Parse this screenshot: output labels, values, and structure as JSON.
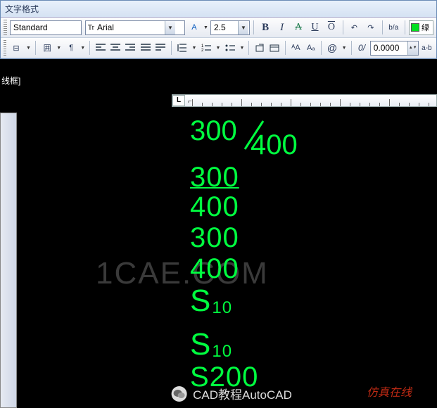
{
  "panel": {
    "title": "文字格式"
  },
  "row1": {
    "style": "Standard",
    "font_prefix": "Tr",
    "font": "Arial",
    "layer_btn": "A",
    "size": "2.5",
    "bold": "B",
    "italic": "I",
    "strike": "A",
    "under": "U",
    "over": "O",
    "undo": "↶",
    "redo": "↷",
    "fraction_btn": "b/a",
    "color_label": "绿"
  },
  "row2": {
    "ruler": "⊟",
    "columns": "囲",
    "para": "¶",
    "align_l": "≡",
    "align_c": "≡",
    "align_r": "≡",
    "align_j": "≡",
    "align_d": "≡",
    "numlist": "≡",
    "bullist": "≡",
    "uclc": "≡",
    "insert": "⎘",
    "fieldA": "ᴬA",
    "fieldAa": "Aₐ",
    "at": "@",
    "slant": "0/",
    "tracking": "0.0000",
    "aab": "a-b"
  },
  "ruler": {
    "L": "L",
    "tab": "⌐"
  },
  "sidebar": {
    "label": "线框]"
  },
  "text": {
    "frac_top": "300",
    "frac_bot": "400",
    "stack_top": "300",
    "stack_bot": "400",
    "l3": "300",
    "l4": "400",
    "s_sup": "S",
    "s_sup_n": "10",
    "s_sub": "S",
    "s_sub_n": "10",
    "s200": "S200"
  },
  "watermark": "1CAE.COM",
  "watermark2": "仿真在线",
  "footer": "CAD教程AutoCAD"
}
